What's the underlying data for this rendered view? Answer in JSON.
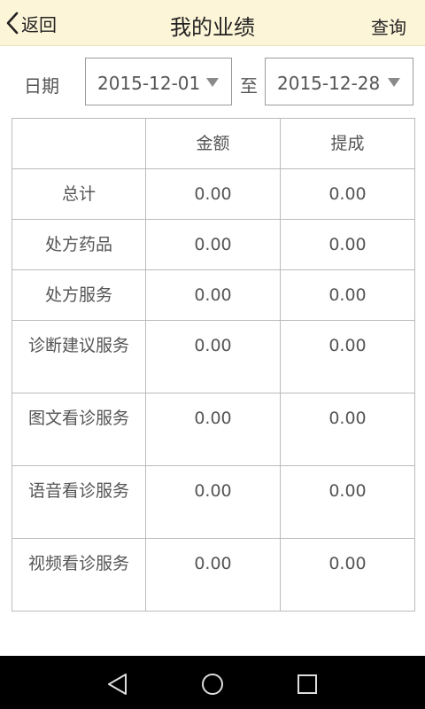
{
  "header": {
    "back_label": "返回",
    "title": "我的业绩",
    "query_label": "查询"
  },
  "date_filter": {
    "label": "日期",
    "start_date": "2015-12-01",
    "to_label": "至",
    "end_date": "2015-12-28"
  },
  "table": {
    "headers": [
      "",
      "金额",
      "提成"
    ],
    "rows": [
      {
        "name": "总计",
        "amount": "0.00",
        "commission": "0.00"
      },
      {
        "name": "处方药品",
        "amount": "0.00",
        "commission": "0.00"
      },
      {
        "name": "处方服务",
        "amount": "0.00",
        "commission": "0.00"
      },
      {
        "name": "诊断建议服务",
        "amount": "0.00",
        "commission": "0.00"
      },
      {
        "name": "图文看诊服务",
        "amount": "0.00",
        "commission": "0.00"
      },
      {
        "name": "语音看诊服务",
        "amount": "0.00",
        "commission": "0.00"
      },
      {
        "name": "视频看诊服务",
        "amount": "0.00",
        "commission": "0.00"
      }
    ]
  },
  "nav_bar": {
    "icons": [
      "back-triangle-icon",
      "home-circle-icon",
      "recent-apps-square-icon"
    ]
  }
}
